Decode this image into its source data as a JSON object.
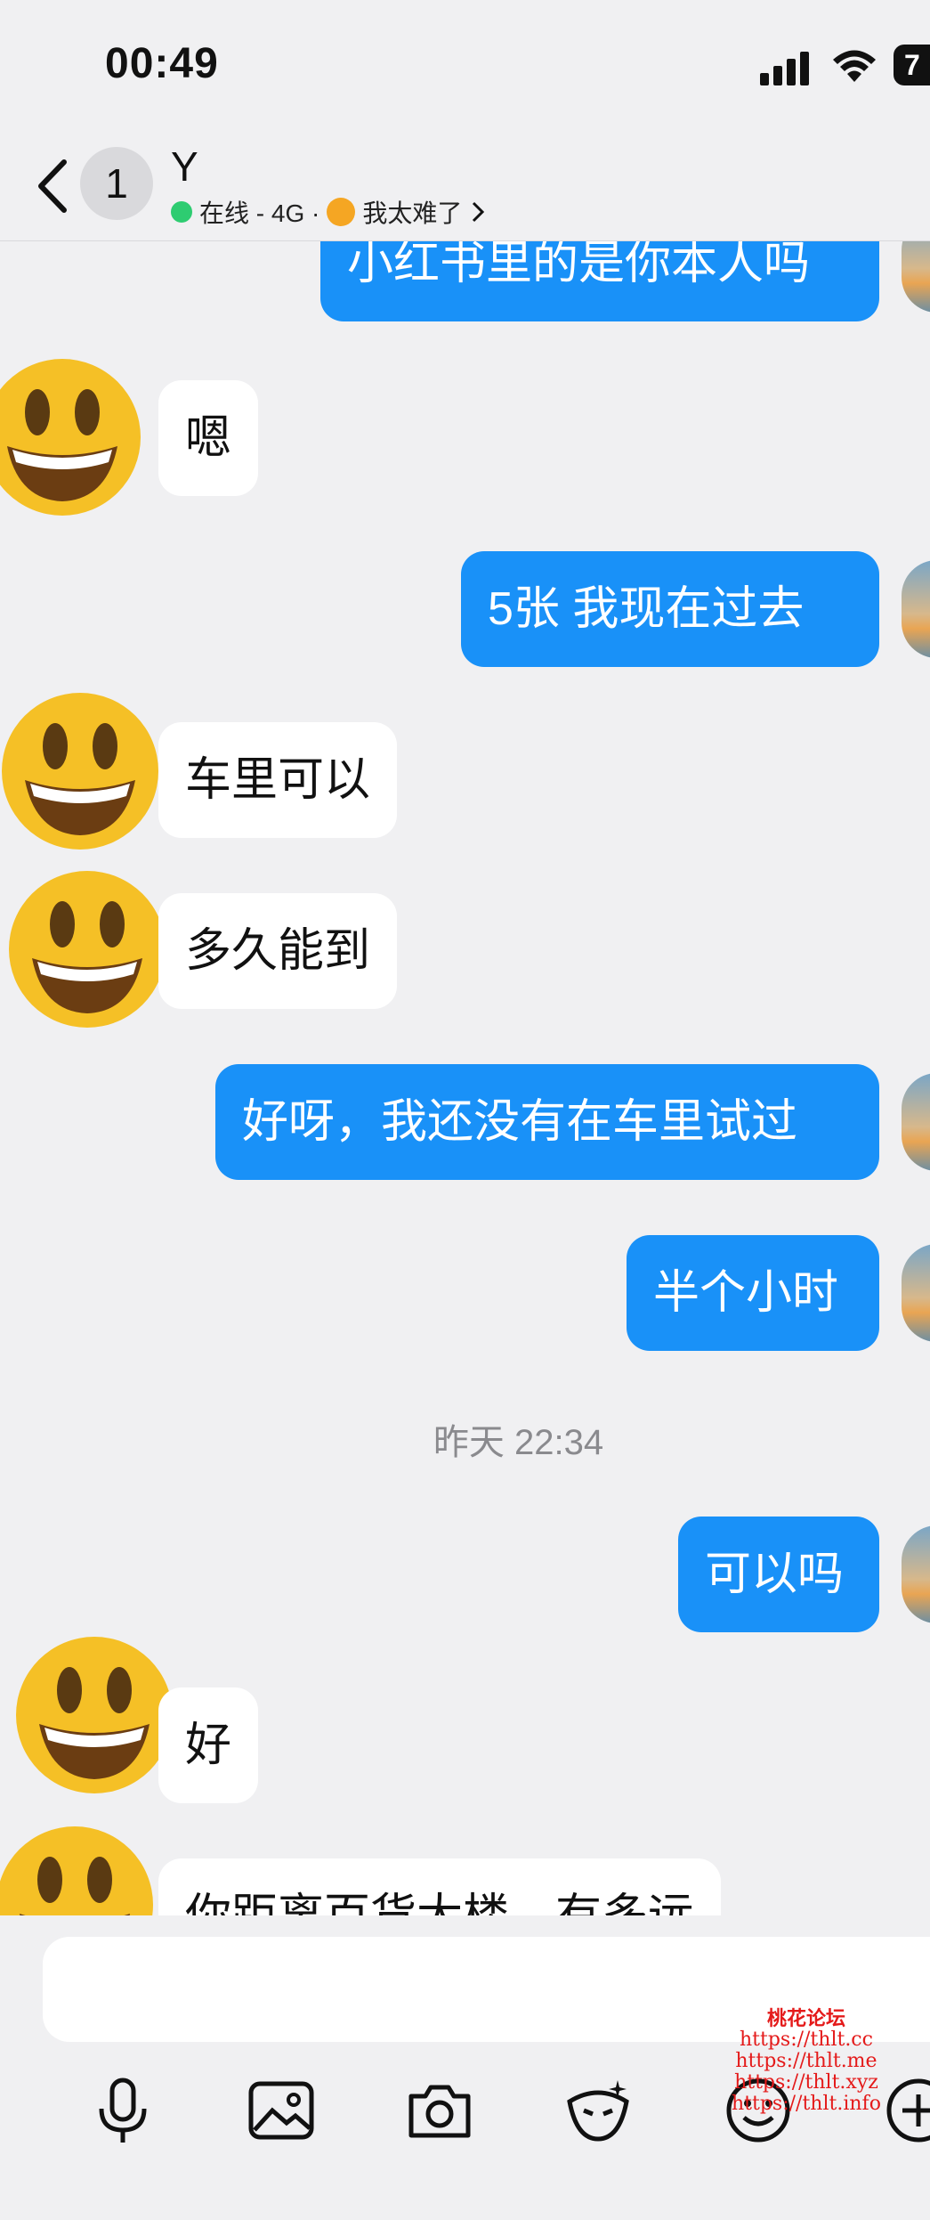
{
  "status": {
    "time": "00:49",
    "battery": "7"
  },
  "header": {
    "unread_count": "1",
    "contact_name": "Y",
    "presence": "在线 - 4G · ",
    "status_text": "我太难了"
  },
  "messages": [
    {
      "side": "me",
      "text": "小红书里的是你本人吗"
    },
    {
      "side": "them",
      "text": "嗯"
    },
    {
      "side": "me",
      "text": "5张  我现在过去"
    },
    {
      "side": "them",
      "text": "车里可以"
    },
    {
      "side": "them",
      "text": "多久能到"
    },
    {
      "side": "me",
      "text": "好呀，我还没有在车里试过"
    },
    {
      "side": "me",
      "text": "半个小时"
    },
    {
      "side": "timestamp",
      "text": "昨天 22:34"
    },
    {
      "side": "me",
      "text": "可以吗"
    },
    {
      "side": "them",
      "text": "好"
    },
    {
      "side": "them",
      "text": "你距离百货大楼，有多远"
    }
  ],
  "toolbar": {
    "icons": [
      "microphone-icon",
      "image-icon",
      "camera-icon",
      "sticker-icon",
      "emoji-icon",
      "plus-icon"
    ]
  },
  "watermark": {
    "title": "桃花论坛",
    "urls": [
      "https://thlt.cc",
      "https://thlt.me",
      "https://thlt.xyz",
      "https://thlt.info"
    ]
  },
  "colors": {
    "my_bubble": "#1991f8",
    "their_bubble": "#ffffff",
    "background": "#f0f0f2",
    "online": "#2ecc71"
  }
}
